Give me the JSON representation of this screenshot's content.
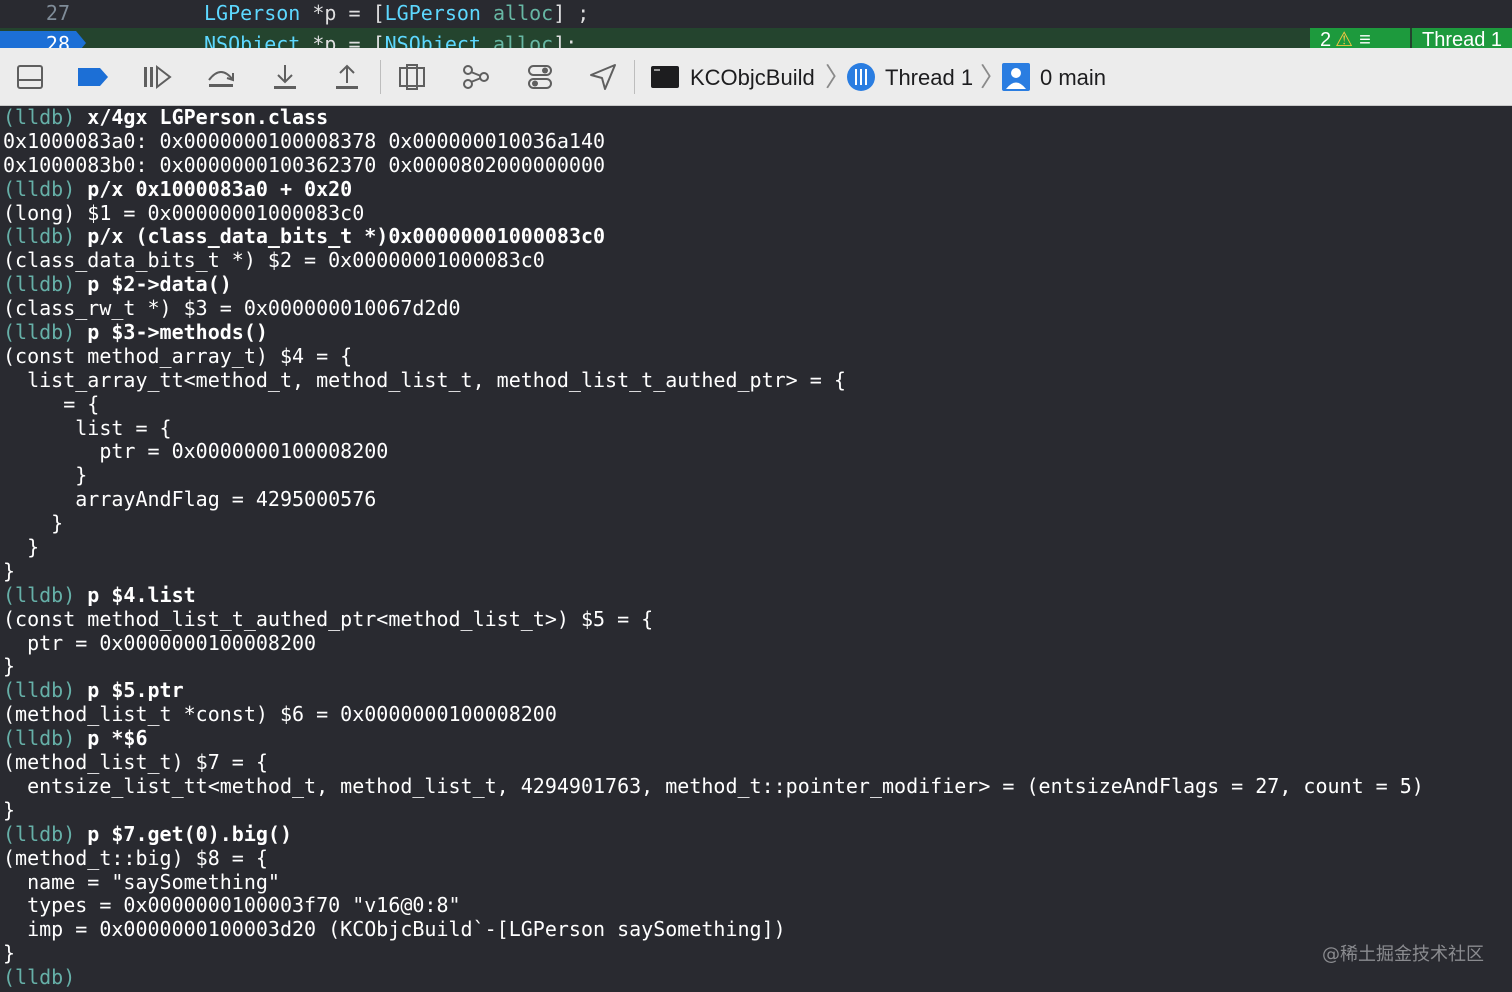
{
  "editor": {
    "line27": {
      "number": "27",
      "type1": "LGPerson",
      "mid": " *p = [",
      "type2": "LGPerson",
      "sp": " ",
      "method": "alloc",
      "end": "] ;"
    },
    "line28": {
      "number": "28",
      "type1": "NSObject",
      "mid": " *p = [",
      "type2": "NSObject",
      "sp": " ",
      "method": "alloc",
      "end": "];"
    },
    "issue_count": "2",
    "thread_label": "Thread 1"
  },
  "toolbar": {
    "target_name": "KCObjcBuild",
    "thread_name": "Thread 1",
    "frame_name": "0 main"
  },
  "console": {
    "lines": [
      {
        "prompt": "(lldb) ",
        "cmd": "x/4gx LGPerson.class",
        "text": ""
      },
      {
        "prompt": "",
        "cmd": "",
        "text": "0x1000083a0: 0x0000000100008378 0x000000010036a140"
      },
      {
        "prompt": "",
        "cmd": "",
        "text": "0x1000083b0: 0x0000000100362370 0x0000802000000000"
      },
      {
        "prompt": "(lldb) ",
        "cmd": "p/x 0x1000083a0 + 0x20",
        "text": ""
      },
      {
        "prompt": "",
        "cmd": "",
        "text": "(long) $1 = 0x00000001000083c0"
      },
      {
        "prompt": "(lldb) ",
        "cmd": "p/x (class_data_bits_t *)0x00000001000083c0",
        "text": ""
      },
      {
        "prompt": "",
        "cmd": "",
        "text": "(class_data_bits_t *) $2 = 0x00000001000083c0"
      },
      {
        "prompt": "(lldb) ",
        "cmd": "p $2->data()",
        "text": ""
      },
      {
        "prompt": "",
        "cmd": "",
        "text": "(class_rw_t *) $3 = 0x000000010067d2d0"
      },
      {
        "prompt": "(lldb) ",
        "cmd": "p $3->methods()",
        "text": ""
      },
      {
        "prompt": "",
        "cmd": "",
        "text": "(const method_array_t) $4 = {"
      },
      {
        "prompt": "",
        "cmd": "",
        "text": "  list_array_tt<method_t, method_list_t, method_list_t_authed_ptr> = {"
      },
      {
        "prompt": "",
        "cmd": "",
        "text": "     = {"
      },
      {
        "prompt": "",
        "cmd": "",
        "text": "      list = {"
      },
      {
        "prompt": "",
        "cmd": "",
        "text": "        ptr = 0x0000000100008200"
      },
      {
        "prompt": "",
        "cmd": "",
        "text": "      }"
      },
      {
        "prompt": "",
        "cmd": "",
        "text": "      arrayAndFlag = 4295000576"
      },
      {
        "prompt": "",
        "cmd": "",
        "text": "    }"
      },
      {
        "prompt": "",
        "cmd": "",
        "text": "  }"
      },
      {
        "prompt": "",
        "cmd": "",
        "text": "}"
      },
      {
        "prompt": "(lldb) ",
        "cmd": "p $4.list",
        "text": ""
      },
      {
        "prompt": "",
        "cmd": "",
        "text": "(const method_list_t_authed_ptr<method_list_t>) $5 = {"
      },
      {
        "prompt": "",
        "cmd": "",
        "text": "  ptr = 0x0000000100008200"
      },
      {
        "prompt": "",
        "cmd": "",
        "text": "}"
      },
      {
        "prompt": "(lldb) ",
        "cmd": "p $5.ptr",
        "text": ""
      },
      {
        "prompt": "",
        "cmd": "",
        "text": "(method_list_t *const) $6 = 0x0000000100008200"
      },
      {
        "prompt": "(lldb) ",
        "cmd": "p *$6",
        "text": ""
      },
      {
        "prompt": "",
        "cmd": "",
        "text": "(method_list_t) $7 = {"
      },
      {
        "prompt": "",
        "cmd": "",
        "text": "  entsize_list_tt<method_t, method_list_t, 4294901763, method_t::pointer_modifier> = (entsizeAndFlags = 27, count = 5)"
      },
      {
        "prompt": "",
        "cmd": "",
        "text": "}"
      },
      {
        "prompt": "(lldb) ",
        "cmd": "p $7.get(0).big()",
        "text": ""
      },
      {
        "prompt": "",
        "cmd": "",
        "text": "(method_t::big) $8 = {"
      },
      {
        "prompt": "",
        "cmd": "",
        "text": "  name = \"saySomething\""
      },
      {
        "prompt": "",
        "cmd": "",
        "text": "  types = 0x0000000100003f70 \"v16@0:8\""
      },
      {
        "prompt": "",
        "cmd": "",
        "text": "  imp = 0x0000000100003d20 (KCObjcBuild`-[LGPerson saySomething])"
      },
      {
        "prompt": "",
        "cmd": "",
        "text": "}"
      },
      {
        "prompt": "(lldb)",
        "cmd": "",
        "text": ""
      }
    ]
  },
  "watermark": "@稀土掘金技术社区",
  "icons": {
    "hide_console": "panel-toggle-icon",
    "breakpoints": "breakpoint-icon",
    "continue": "continue-icon",
    "step_over": "step-over-icon",
    "step_into": "step-into-icon",
    "step_out": "step-out-icon",
    "view_hierarchy": "view-debugger-icon",
    "memory_graph": "memory-graph-icon",
    "env_overrides": "environment-overrides-icon",
    "location": "simulate-location-icon",
    "target": "terminal-icon",
    "thread": "thread-icon",
    "frame": "frame-icon",
    "warning": "warning-icon"
  },
  "colors": {
    "prompt": "#66b0a8",
    "type": "#5dd8ff",
    "accent": "#1c6fd6",
    "badge": "#1d9a3d"
  }
}
